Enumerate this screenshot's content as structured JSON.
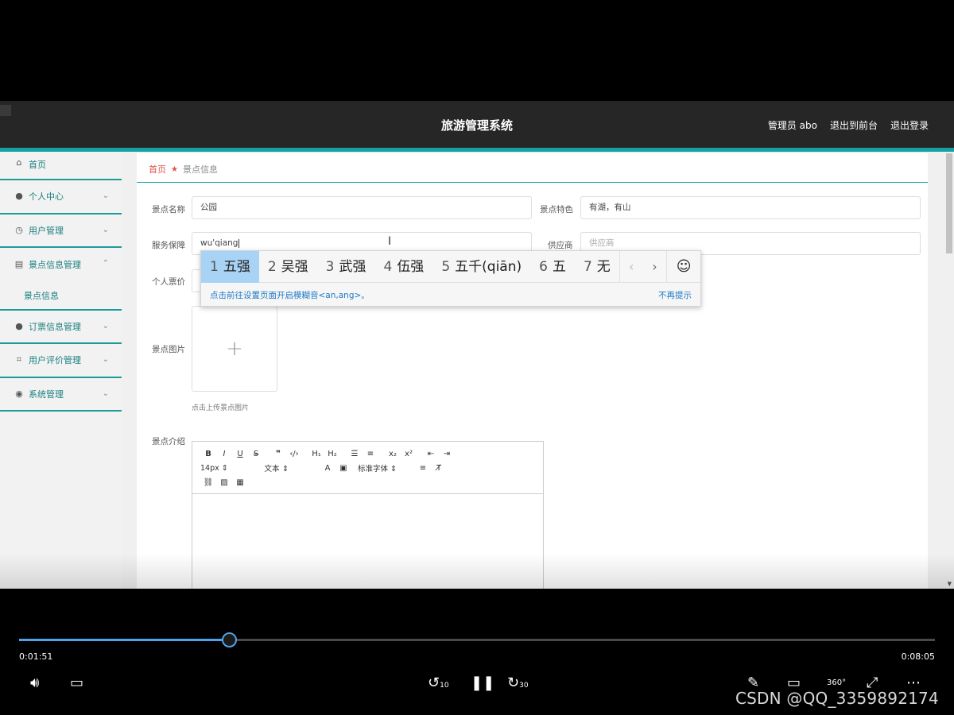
{
  "header": {
    "title": "旅游管理系统",
    "user": "管理员 abo",
    "to_front": "退出到前台",
    "logout": "退出登录"
  },
  "sidebar": {
    "items": [
      {
        "label": "首页",
        "icon": "home-icon"
      },
      {
        "label": "个人中心",
        "icon": "user-icon"
      },
      {
        "label": "用户管理",
        "icon": "clock-icon"
      },
      {
        "label": "景点信息管理",
        "icon": "clipboard-icon"
      },
      {
        "label": "景点信息",
        "icon": ""
      },
      {
        "label": "订票信息管理",
        "icon": "location-icon"
      },
      {
        "label": "用户评价管理",
        "icon": "crop-icon"
      },
      {
        "label": "系统管理",
        "icon": "compass-icon"
      }
    ]
  },
  "breadcrumb": {
    "home": "首页",
    "current": "景点信息"
  },
  "form": {
    "name_label": "景点名称",
    "name_value": "公园",
    "feature_label": "景点特色",
    "feature_value": "有湖，有山",
    "service_label": "服务保障",
    "service_value": "wu'qiang",
    "supplier_label": "供应商",
    "supplier_placeholder": "供应商",
    "price_label": "个人票价",
    "image_label": "景点图片",
    "upload_hint": "点击上传景点图片",
    "intro_label": "景点介绍"
  },
  "editor": {
    "font_size": "14px",
    "text_style": "文本",
    "font_family": "标准字体"
  },
  "ime": {
    "candidates": [
      {
        "n": "1",
        "text": "五强"
      },
      {
        "n": "2",
        "text": "吴强"
      },
      {
        "n": "3",
        "text": "武强"
      },
      {
        "n": "4",
        "text": "伍强"
      },
      {
        "n": "5",
        "text": "五千(qiān)"
      },
      {
        "n": "6",
        "text": "五"
      },
      {
        "n": "7",
        "text": "无"
      }
    ],
    "tip": "点击前往设置页面开启模糊音<an,ang>。",
    "dismiss": "不再提示"
  },
  "player": {
    "current_time": "0:01:51",
    "total_time": "0:08:05",
    "progress": 0.229,
    "rewind_seconds": "10",
    "forward_seconds": "30",
    "vr_label": "360°"
  },
  "watermark": "CSDN @QQ_3359892174"
}
